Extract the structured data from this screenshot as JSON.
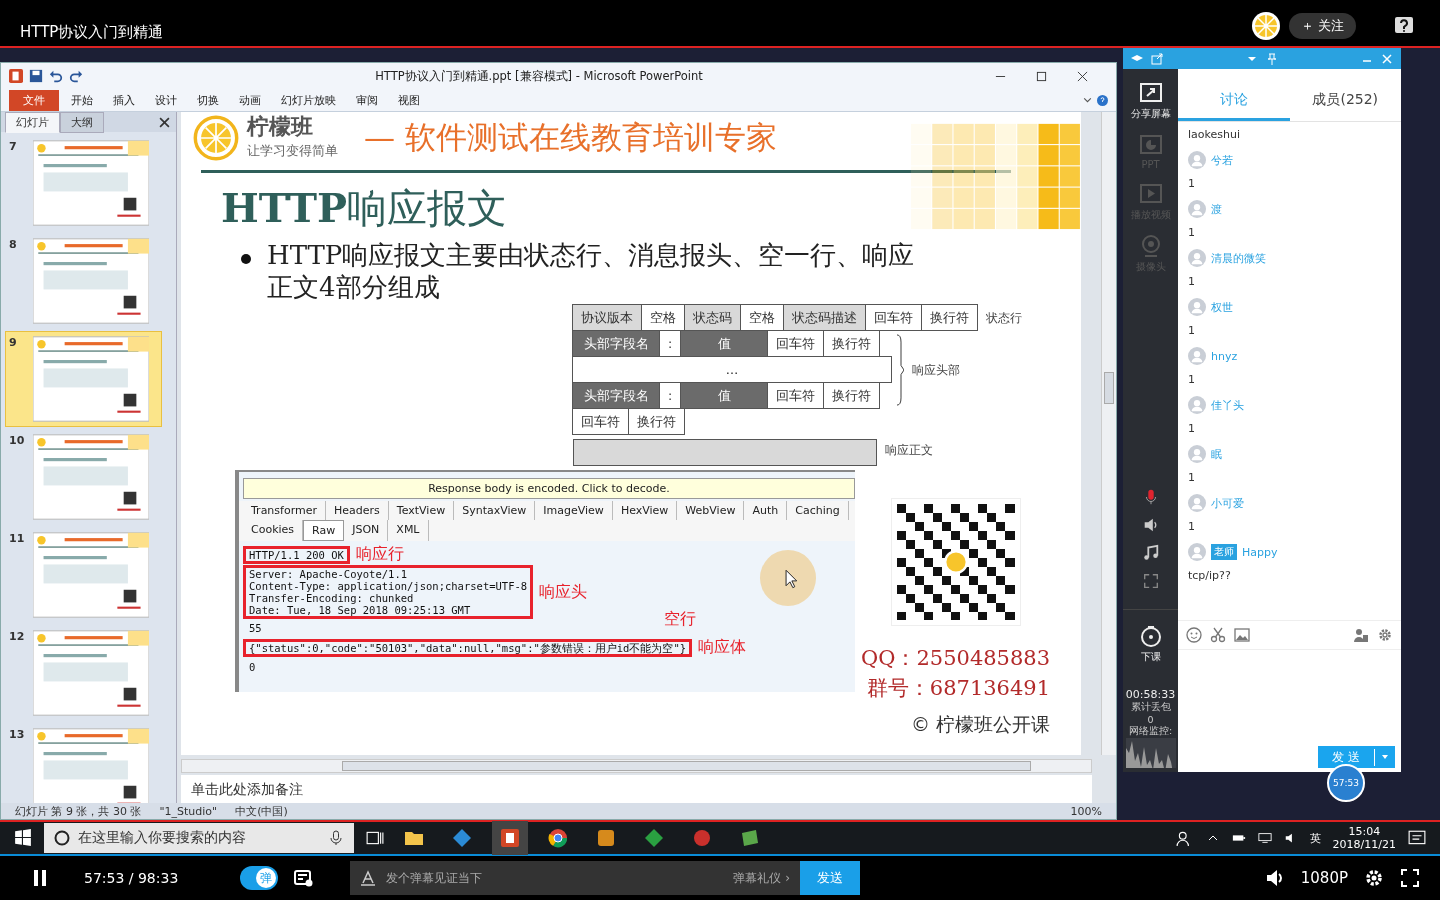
{
  "video": {
    "title": "HTTP协议入门到精通",
    "follow": "＋ 关注"
  },
  "ppt": {
    "title": "HTTP协议入门到精通.ppt [兼容模式] - Microsoft PowerPoint",
    "file_tab": "文件",
    "ribbon_tabs": [
      "开始",
      "插入",
      "设计",
      "切换",
      "动画",
      "幻灯片放映",
      "审阅",
      "视图"
    ],
    "pane_tabs": [
      {
        "label": "幻灯片",
        "selected": true
      },
      {
        "label": "大纲",
        "selected": false
      }
    ],
    "slides": [
      {
        "number": "7",
        "selected": false
      },
      {
        "number": "8",
        "selected": false
      },
      {
        "number": "9",
        "selected": true
      },
      {
        "number": "10",
        "selected": false
      },
      {
        "number": "11",
        "selected": false
      },
      {
        "number": "12",
        "selected": false
      },
      {
        "number": "13",
        "selected": false
      }
    ],
    "notes_placeholder": "单击此处添加备注",
    "status_bar": [
      "幻灯片 第 9 张，共 30 张",
      "\"1_Studio\"",
      "中文(中国)"
    ],
    "zoom": "100%"
  },
  "slide": {
    "brand": "柠檬班",
    "slogan": "让学习变得简单",
    "tagline": "— 软件测试在线教育培训专家",
    "title": "**HTTP**响应报文",
    "bullet": "HTTP响应报文主要由状态行、消息报头、空一行、响应正文4部分组成",
    "diagram": {
      "status_line": {
        "label": "状态行",
        "cells": [
          {
            "text": "协议版本",
            "kind": "light"
          },
          {
            "text": "空格",
            "kind": "white"
          },
          {
            "text": "状态码",
            "kind": "light"
          },
          {
            "text": "空格",
            "kind": "white"
          },
          {
            "text": "状态码描述",
            "kind": "light"
          },
          {
            "text": "回车符",
            "kind": "white"
          },
          {
            "text": "换行符",
            "kind": "white"
          }
        ]
      },
      "headers": {
        "label": "响应头部",
        "rows": [
          [
            {
              "text": "头部字段名",
              "kind": "dark"
            },
            {
              "text": ":",
              "kind": "white"
            },
            {
              "text": "值",
              "kind": "dark"
            },
            {
              "text": "回车符",
              "kind": "white"
            },
            {
              "text": "换行符",
              "kind": "white"
            }
          ],
          [
            {
              "text": "…",
              "kind": "wide"
            }
          ],
          [
            {
              "text": "头部字段名",
              "kind": "dark"
            },
            {
              "text": ":",
              "kind": "white"
            },
            {
              "text": "值",
              "kind": "dark"
            },
            {
              "text": "回车符",
              "kind": "white"
            },
            {
              "text": "换行符",
              "kind": "white"
            }
          ]
        ]
      },
      "blank_line": [
        {
          "text": "回车符",
          "kind": "white"
        },
        {
          "text": "换行符",
          "kind": "white"
        }
      ],
      "body_label": "响应正文"
    },
    "inspector": {
      "banner": "Response body is encoded. Click to decode.",
      "tabs": [
        "Transformer",
        "Headers",
        "TextView",
        "SyntaxView",
        "ImageView",
        "HexView",
        "WebView",
        "Auth",
        "Caching"
      ],
      "subtabs": [
        {
          "label": "Cookies",
          "selected": false
        },
        {
          "label": "Raw",
          "selected": true
        },
        {
          "label": "JSON",
          "selected": false
        },
        {
          "label": "XML",
          "selected": false
        }
      ],
      "blocks": [
        {
          "lines": [
            "HTTP/1.1 200 OK"
          ],
          "boxed": true,
          "note": "响应行"
        },
        {
          "lines": [
            "Server: Apache-Coyote/1.1",
            "Content-Type: application/json;charset=UTF-8",
            "Transfer-Encoding: chunked",
            "Date: Tue, 18 Sep 2018 09:25:13 GMT"
          ],
          "boxed": true,
          "note": "响应头"
        },
        {
          "lines": [
            "55"
          ],
          "boxed": false,
          "note": "空行"
        },
        {
          "lines": [
            "{\"status\":0,\"code\":\"50103\",\"data\":null,\"msg\":\"参数错误：用户id不能为空\"}"
          ],
          "boxed": true,
          "note": "响应体"
        },
        {
          "lines": [
            "0"
          ],
          "boxed": false
        }
      ]
    },
    "contacts": [
      "QQ：2550485883",
      "群号：687136491"
    ],
    "copyright": "© 柠檬班公开课"
  },
  "classroom": {
    "tools": [
      {
        "kind": "share",
        "label": "分享屏幕",
        "disabled": false
      },
      {
        "kind": "ppt",
        "label": "PPT",
        "disabled": true
      },
      {
        "kind": "video",
        "label": "播放视频",
        "disabled": true
      },
      {
        "kind": "camera",
        "label": "摄像头",
        "disabled": true
      }
    ],
    "end_class": "下课",
    "elapsed": "00:58:33",
    "loss_label": "累计丢包",
    "loss": "0",
    "network_label": "网络监控:",
    "tabs": [
      {
        "label": "讨论",
        "selected": true
      },
      {
        "label": "成员(252)",
        "selected": false
      }
    ],
    "messages": [
      {
        "kind": "text",
        "text": "laokeshui"
      },
      {
        "kind": "message",
        "name": "兮若",
        "text": "1"
      },
      {
        "kind": "message",
        "name": "渡",
        "text": "1"
      },
      {
        "kind": "message",
        "name": "清晨的微笑",
        "text": "1"
      },
      {
        "kind": "message",
        "name": "权世",
        "text": "1"
      },
      {
        "kind": "message",
        "name": "hnyz",
        "text": "1"
      },
      {
        "kind": "message",
        "name": "佳丫头",
        "text": "1"
      },
      {
        "kind": "message",
        "name": "眠",
        "text": "1"
      },
      {
        "kind": "message",
        "name": "小可爱",
        "text": "1"
      },
      {
        "kind": "message",
        "name": "Happy",
        "badge": "老师",
        "text": "tcp/ip??"
      }
    ],
    "send": "发 送",
    "timer": "57:53"
  },
  "taskbar": {
    "search_placeholder": "在这里输入你要搜索的内容",
    "ime": "英",
    "time": "15:04",
    "date": "2018/11/21"
  },
  "player": {
    "time": "57:53 / 98:33",
    "danmaku_on": true,
    "danmaku_toggle": "弹",
    "danmaku_placeholder": "发个弹幕见证当下",
    "etiquette": "弹幕礼仪 ›",
    "send": "发送",
    "quality": "1080P"
  }
}
